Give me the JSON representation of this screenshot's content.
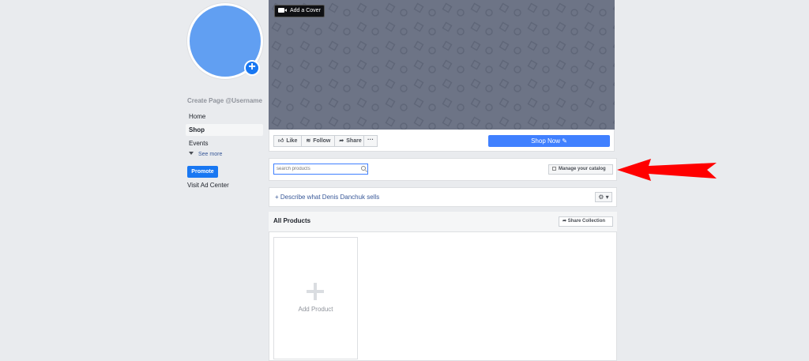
{
  "sidebar": {
    "create_page": "Create Page @Username",
    "nav": [
      "Home",
      "Shop",
      "Events"
    ],
    "active": "Shop",
    "see_more": "See more",
    "promote": "Promote",
    "ad_center": "Visit Ad Center"
  },
  "cover": {
    "add_cover": "Add a Cover"
  },
  "actions": {
    "like": "Like",
    "follow": "Follow",
    "share": "Share",
    "more": "···",
    "shop_now": "Shop Now ✎"
  },
  "search": {
    "placeholder": "search products",
    "manage": "Manage your catalog"
  },
  "describe": {
    "link": "+ Describe what Denis Danchuk sells",
    "gear": "⚙ ▾"
  },
  "products": {
    "title": "All Products",
    "share_collection": "Share Collection",
    "add_product": "Add Product"
  },
  "colors": {
    "brand_blue": "#1877f2",
    "shop_now_blue": "#4080ff",
    "annotation_red": "#ff0000"
  }
}
